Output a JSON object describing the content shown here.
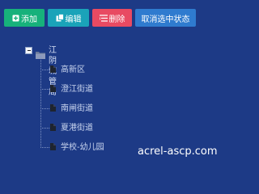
{
  "toolbar": {
    "add_label": "添加",
    "edit_label": "编辑",
    "delete_label": "删除",
    "clear_label": "取消选中状态"
  },
  "tree": {
    "root_label": "江阴城管局",
    "children": [
      "高新区",
      "澄江街道",
      "南闸街道",
      "夏港街道",
      "学校-幼儿园"
    ]
  },
  "watermark": "acrel-ascp.com",
  "colors": {
    "background": "#1d3a86",
    "add": "#17b17b",
    "edit": "#1aa3b9",
    "delete": "#e84a62",
    "clear": "#2f7bcf"
  }
}
